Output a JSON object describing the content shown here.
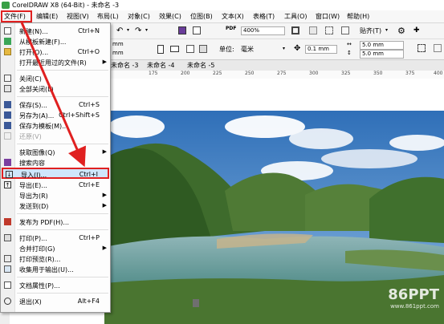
{
  "window": {
    "title": "CorelDRAW X8 (64-Bit) - 未命名 -3"
  },
  "menubar": {
    "items": [
      "文件(F)",
      "编辑(E)",
      "视图(V)",
      "布局(L)",
      "对象(C)",
      "效果(C)",
      "位图(B)",
      "文本(X)",
      "表格(T)",
      "工具(O)",
      "窗口(W)",
      "帮助(H)"
    ]
  },
  "toolbar": {
    "zoom": "400%",
    "snap_label": "贴齐(T)",
    "pdf_label": "PDF",
    "size_w": "mm",
    "size_h": "mm",
    "unit_label": "单位:",
    "unit_value": "毫米",
    "nudge": "0.1 mm",
    "dup_x": "5.0 mm",
    "dup_y": "5.0 mm"
  },
  "tabs": [
    "未命名 -3",
    "未命名 -4",
    "未命名 -5"
  ],
  "ruler": {
    "ticks": [
      "175",
      "200",
      "225",
      "250",
      "275",
      "300",
      "325",
      "350",
      "375",
      "400"
    ]
  },
  "file_menu": {
    "items": [
      {
        "label": "新建(N)...",
        "shortcut": "Ctrl+N",
        "icon": "new-doc-icon"
      },
      {
        "label": "从模板新建(F)...",
        "shortcut": "",
        "icon": "template-icon"
      },
      {
        "label": "打开(O)...",
        "shortcut": "Ctrl+O",
        "icon": "open-folder-icon"
      },
      {
        "label": "打开最近用过的文件(R)",
        "shortcut": "",
        "icon": "",
        "submenu": true
      },
      {
        "label": "关闭(C)",
        "shortcut": "",
        "icon": "close-doc-icon"
      },
      {
        "label": "全部关闭(L)",
        "shortcut": "",
        "icon": "close-all-icon"
      },
      {
        "label": "保存(S)...",
        "shortcut": "Ctrl+S",
        "icon": "save-icon"
      },
      {
        "label": "另存为(A)...",
        "shortcut": "Ctrl+Shift+S",
        "icon": "save-as-icon"
      },
      {
        "label": "保存为模板(M)...",
        "shortcut": "",
        "icon": "save-template-icon"
      },
      {
        "label": "还原(V)",
        "shortcut": "",
        "icon": "revert-icon",
        "disabled": true
      },
      {
        "label": "获取图像(Q)",
        "shortcut": "",
        "icon": "acquire-icon",
        "submenu": true
      },
      {
        "label": "搜索内容",
        "shortcut": "",
        "icon": "search-content-icon"
      },
      {
        "label": "导入(I)...",
        "shortcut": "Ctrl+I",
        "icon": "import-icon",
        "highlighted": true
      },
      {
        "label": "导出(E)...",
        "shortcut": "Ctrl+E",
        "icon": "export-icon"
      },
      {
        "label": "导出为(R)",
        "shortcut": "",
        "icon": "",
        "submenu": true
      },
      {
        "label": "发送到(D)",
        "shortcut": "",
        "icon": "",
        "submenu": true
      },
      {
        "label": "发布为 PDF(H)...",
        "shortcut": "",
        "icon": "pdf-icon"
      },
      {
        "label": "打印(P)...",
        "shortcut": "Ctrl+P",
        "icon": "print-icon"
      },
      {
        "label": "合并打印(G)",
        "shortcut": "",
        "icon": "merge-print-icon",
        "submenu": true
      },
      {
        "label": "打印预览(R)...",
        "shortcut": "",
        "icon": "print-preview-icon"
      },
      {
        "label": "收集用于输出(U)...",
        "shortcut": "",
        "icon": "collect-output-icon"
      },
      {
        "label": "文档属性(P)...",
        "shortcut": "",
        "icon": "doc-properties-icon"
      },
      {
        "label": "退出(X)",
        "shortcut": "Alt+F4",
        "icon": "exit-icon"
      }
    ]
  },
  "watermark": {
    "brand": "86",
    "brand2": "PPT",
    "url": "www.861ppt.com"
  },
  "colors": {
    "highlight_border": "#e02020",
    "arrow": "#e02020",
    "menu_hover": "#cfe6fb"
  }
}
